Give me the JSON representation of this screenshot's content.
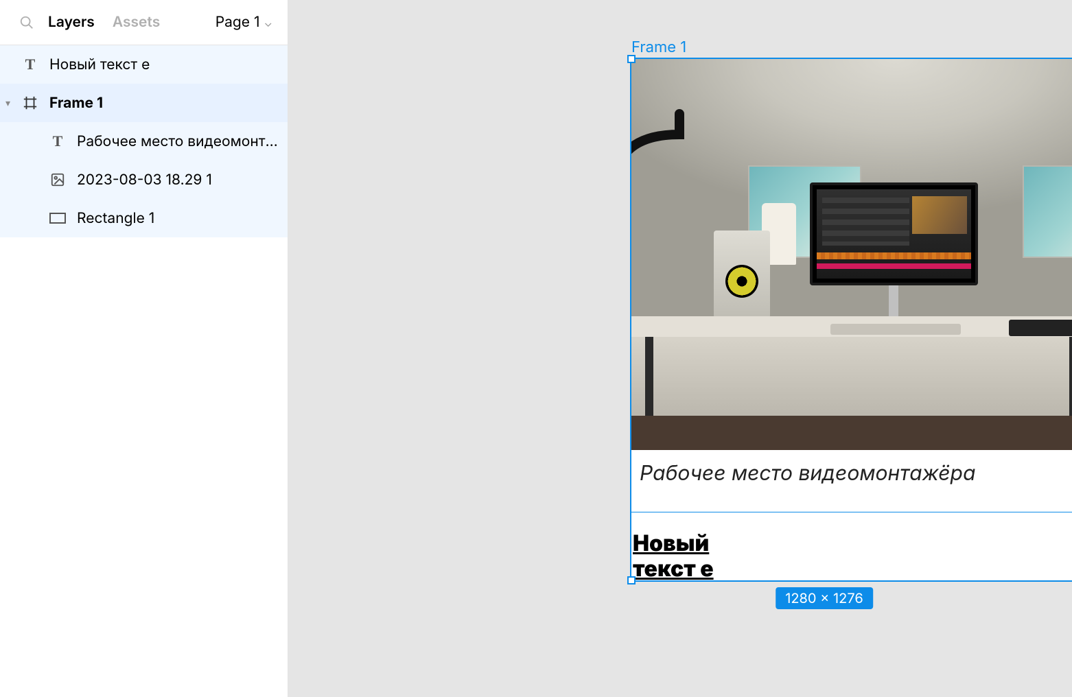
{
  "panel": {
    "tabs": {
      "layers": "Layers",
      "assets": "Assets"
    },
    "page_selector": "Page 1"
  },
  "layers": [
    {
      "name": "Новый текст е",
      "icon": "text",
      "depth": 0,
      "state": "childsel"
    },
    {
      "name": "Frame 1",
      "icon": "frame",
      "depth": 0,
      "state": "selected",
      "expanded": true
    },
    {
      "name": "Рабочее место видеомонта...",
      "icon": "text",
      "depth": 1,
      "state": "childsel"
    },
    {
      "name": "2023-08-03 18.29 1",
      "icon": "image",
      "depth": 1,
      "state": "childsel"
    },
    {
      "name": "Rectangle 1",
      "icon": "rectangle",
      "depth": 1,
      "state": "childsel"
    }
  ],
  "canvas": {
    "frame_label": "Frame 1",
    "caption_text": "Рабочее место видеомонтажёра",
    "overflow_text": "Новый текст е",
    "size_badge": "1280 × 1276"
  },
  "icons": {
    "text": "T",
    "frame": "frame-svg",
    "image": "image-svg",
    "rectangle": "rect-svg",
    "search": "search-svg",
    "caret": "⌄"
  }
}
